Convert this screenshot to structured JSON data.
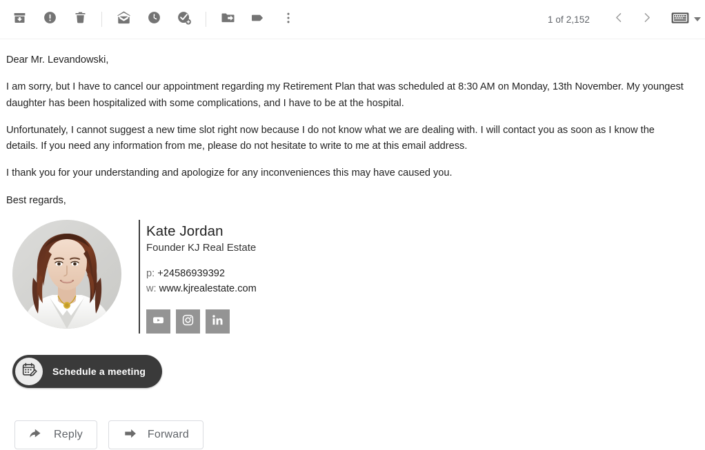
{
  "toolbar": {
    "actions": [
      {
        "name": "archive-icon",
        "title": "Archive"
      },
      {
        "name": "report-spam-icon",
        "title": "Report spam"
      },
      {
        "name": "delete-icon",
        "title": "Delete"
      },
      {
        "name": "mark-unread-icon",
        "title": "Mark as unread"
      },
      {
        "name": "snooze-icon",
        "title": "Snooze"
      },
      {
        "name": "add-to-tasks-icon",
        "title": "Add to tasks"
      },
      {
        "name": "move-to-icon",
        "title": "Move to"
      },
      {
        "name": "labels-icon",
        "title": "Labels"
      },
      {
        "name": "more-options-icon",
        "title": "More"
      }
    ],
    "counter": "1 of 2,152",
    "prev_title": "Older",
    "next_title": "Newer",
    "keyboard_icon": "keyboard-icon",
    "keyboard_caret": "chevron-down-icon"
  },
  "email": {
    "greeting": "Dear Mr. Levandowski,",
    "paragraph_1": "I am sorry, but I have to cancel our appointment regarding my Retirement Plan that was scheduled at 8:30 AM on Monday, 13th November. My youngest daughter has been hospitalized with some complications, and I have to be at the hospital.",
    "paragraph_2": "Unfortunately, I cannot suggest a new time slot right now because I do not know what we are dealing with. I will contact you as soon as I know the details. If you need any information from me, please do not hesitate to write to me at this email address.",
    "paragraph_3": "I thank you for your understanding and apologize for any inconveniences this may have caused you.",
    "closing": "Best regards,"
  },
  "signature": {
    "avatar_alt": "Kate Jordan portrait",
    "name": "Kate Jordan",
    "role": "Founder KJ Real Estate",
    "phone_label": "p:",
    "phone": "+24586939392",
    "web_label": "w:",
    "web": "www.kjrealestate.com",
    "socials": [
      {
        "name": "youtube-icon",
        "title": "YouTube"
      },
      {
        "name": "instagram-icon",
        "title": "Instagram"
      },
      {
        "name": "linkedin-icon",
        "title": "LinkedIn"
      }
    ]
  },
  "schedule_button": {
    "label": "Schedule a meeting",
    "icon": "calendar-edit-icon"
  },
  "actions": {
    "reply_label": "Reply",
    "reply_icon": "reply-arrow-icon",
    "forward_label": "Forward",
    "forward_icon": "forward-arrow-icon"
  },
  "colors": {
    "icon_gray": "#747474",
    "text_dark": "#222222",
    "meta_gray": "#5f6368",
    "social_gray": "#949494",
    "schedule_dark": "#3a3a3a"
  }
}
